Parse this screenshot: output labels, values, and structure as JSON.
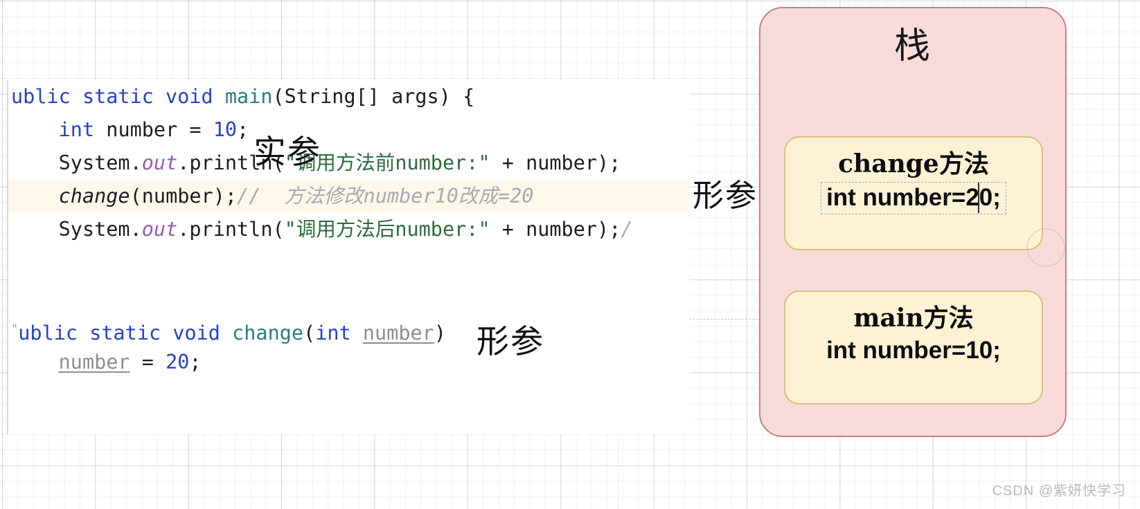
{
  "code_panel": {
    "lines": [
      {
        "id": "line-main-signature",
        "highlight": false,
        "segments": [
          {
            "cls": "tok-kw",
            "text": "ublic static void "
          },
          {
            "cls": "tok-method",
            "text": "main"
          },
          {
            "cls": "tok-plain",
            "text": "(String[] args) {"
          }
        ]
      },
      {
        "id": "line-declare-number",
        "highlight": false,
        "segments": [
          {
            "cls": "tok-plain",
            "text": "    "
          },
          {
            "cls": "tok-type",
            "text": "int"
          },
          {
            "cls": "tok-plain",
            "text": " number = "
          },
          {
            "cls": "tok-num",
            "text": "10"
          },
          {
            "cls": "tok-plain",
            "text": ";"
          }
        ]
      },
      {
        "id": "line-println-before",
        "highlight": false,
        "segments": [
          {
            "cls": "tok-plain",
            "text": "    System."
          },
          {
            "cls": "tok-static",
            "text": "out"
          },
          {
            "cls": "tok-plain",
            "text": ".println("
          },
          {
            "cls": "tok-str",
            "text": "\"调用方法前number:\""
          },
          {
            "cls": "tok-plain",
            "text": " + number);"
          }
        ]
      },
      {
        "id": "line-call-change",
        "highlight": true,
        "segments": [
          {
            "cls": "tok-plain",
            "text": "    "
          },
          {
            "cls": "tok-italic",
            "text": "change"
          },
          {
            "cls": "tok-plain",
            "text": "(number);"
          },
          {
            "cls": "tok-comment",
            "text": "//  方法修改number10改成=20"
          }
        ]
      },
      {
        "id": "line-println-after",
        "highlight": false,
        "segments": [
          {
            "cls": "tok-plain",
            "text": "    System."
          },
          {
            "cls": "tok-static",
            "text": "out"
          },
          {
            "cls": "tok-plain",
            "text": ".println("
          },
          {
            "cls": "tok-str",
            "text": "\"调用方法后number:\""
          },
          {
            "cls": "tok-plain",
            "text": " + number);"
          },
          {
            "cls": "tok-comment",
            "text": "/"
          }
        ]
      },
      {
        "id": "line-blank-1",
        "highlight": false,
        "segments": []
      },
      {
        "id": "line-blank-2",
        "highlight": false,
        "segments": []
      },
      {
        "id": "line-change-signature",
        "highlight": false,
        "segments": [
          {
            "cls": "tok-quote-stray",
            "text": "\""
          },
          {
            "cls": "tok-kw",
            "text": "ublic static void "
          },
          {
            "cls": "tok-method",
            "text": "change"
          },
          {
            "cls": "tok-plain",
            "text": "("
          },
          {
            "cls": "tok-type",
            "text": "int"
          },
          {
            "cls": "tok-plain",
            "text": " "
          },
          {
            "cls": "tok-param",
            "text": "number"
          },
          {
            "cls": "tok-plain",
            "text": ")"
          }
        ]
      },
      {
        "id": "line-assign-20",
        "highlight": false,
        "segments": [
          {
            "cls": "tok-plain",
            "text": "    "
          },
          {
            "cls": "tok-param",
            "text": "number"
          },
          {
            "cls": "tok-plain",
            "text": " = "
          },
          {
            "cls": "tok-num",
            "text": "20"
          },
          {
            "cls": "tok-plain",
            "text": ";"
          }
        ]
      }
    ]
  },
  "annotations": {
    "actual_param_label": "实参",
    "formal_param_code_label": "形参",
    "formal_param_stack_label": "形参"
  },
  "stack": {
    "title": "栈",
    "frames": [
      {
        "id": "change-frame",
        "title": "change方法",
        "body": "int number=20;",
        "selected": true
      },
      {
        "id": "main-frame",
        "title": "main方法",
        "body": "int number=10;",
        "selected": false
      }
    ]
  },
  "watermark": {
    "text": "CSDN @紫妍快学习"
  },
  "colors": {
    "stack_fill": "#f9dcd9",
    "stack_border": "#c97f7b",
    "frame_fill": "#fdf2d4",
    "frame_border": "#d9bf7d",
    "highlight_line": "#fdf8ea",
    "selection_dash": "#7fb0de",
    "keyword": "#2343c4",
    "method": "#2b7a86",
    "string": "#2d6b3b",
    "comment": "#a9a9ad",
    "static_field": "#9b59b6"
  }
}
